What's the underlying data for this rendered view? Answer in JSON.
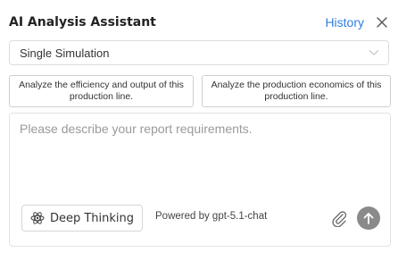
{
  "header": {
    "title": "AI Analysis Assistant",
    "history_label": "History",
    "close_icon": "close-icon",
    "accent_color": "#2f7fe0"
  },
  "mode_select": {
    "value": "Single Simulation",
    "icon": "chevron-down-icon"
  },
  "suggestions": [
    {
      "label": "Analyze the efficiency and output of this production line."
    },
    {
      "label": "Analyze the production economics of this production line."
    }
  ],
  "composer": {
    "placeholder": "Please describe your report requirements.",
    "value": "",
    "deep_thinking_label": "Deep Thinking",
    "deep_thinking_icon": "atom-icon",
    "powered_by": "Powered by gpt-5.1-chat",
    "attach_icon": "paperclip-icon",
    "send_icon": "arrow-up-icon"
  }
}
